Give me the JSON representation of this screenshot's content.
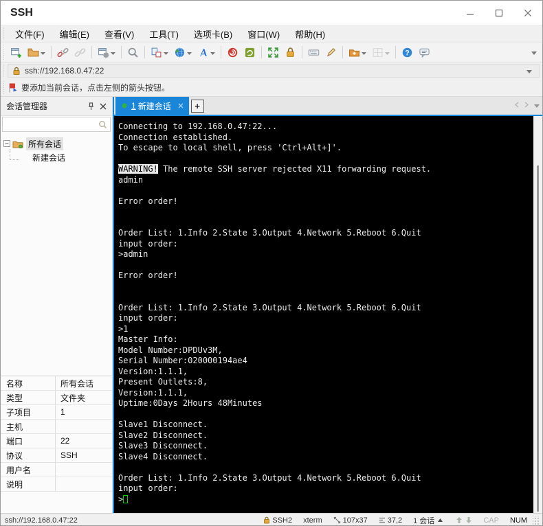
{
  "window": {
    "title": "SSH"
  },
  "menu": {
    "items": [
      {
        "label": "文件(F)"
      },
      {
        "label": "编辑(E)"
      },
      {
        "label": "查看(V)"
      },
      {
        "label": "工具(T)"
      },
      {
        "label": "选项卡(B)"
      },
      {
        "label": "窗口(W)"
      },
      {
        "label": "帮助(H)"
      }
    ]
  },
  "toolbar": {
    "buttons": [
      {
        "icon": "new-session-icon",
        "dropdown": false,
        "sep_before": false,
        "disabled": false
      },
      {
        "icon": "open-folder-icon",
        "dropdown": true,
        "sep_before": false,
        "disabled": false
      },
      {
        "icon": "disconnect-icon",
        "dropdown": false,
        "sep_before": true,
        "disabled": false
      },
      {
        "icon": "reconnect-icon",
        "dropdown": false,
        "sep_before": false,
        "disabled": true
      },
      {
        "icon": "session-properties-icon",
        "dropdown": true,
        "sep_before": true,
        "disabled": false
      },
      {
        "icon": "find-icon",
        "dropdown": false,
        "sep_before": true,
        "disabled": false
      },
      {
        "icon": "layout-tabs-icon",
        "dropdown": true,
        "sep_before": true,
        "disabled": false
      },
      {
        "icon": "web-icon",
        "dropdown": true,
        "sep_before": false,
        "disabled": false
      },
      {
        "icon": "font-icon",
        "dropdown": true,
        "sep_before": false,
        "disabled": false
      },
      {
        "icon": "trace-icon",
        "dropdown": false,
        "sep_before": true,
        "disabled": false
      },
      {
        "icon": "log-icon",
        "dropdown": false,
        "sep_before": false,
        "disabled": false
      },
      {
        "icon": "fullscreen-icon",
        "dropdown": false,
        "sep_before": true,
        "disabled": false
      },
      {
        "icon": "lock-icon",
        "dropdown": false,
        "sep_before": false,
        "disabled": false
      },
      {
        "icon": "keyboard-icon",
        "dropdown": false,
        "sep_before": true,
        "disabled": false
      },
      {
        "icon": "highlight-pen-icon",
        "dropdown": false,
        "sep_before": false,
        "disabled": false
      },
      {
        "icon": "new-folder-icon",
        "dropdown": true,
        "sep_before": true,
        "disabled": false
      },
      {
        "icon": "grid-layout-icon",
        "dropdown": true,
        "sep_before": false,
        "disabled": true
      },
      {
        "icon": "help-icon",
        "dropdown": false,
        "sep_before": true,
        "disabled": false
      },
      {
        "icon": "message-icon",
        "dropdown": false,
        "sep_before": false,
        "disabled": false
      }
    ]
  },
  "address_bar": {
    "value": "ssh://192.168.0.47:22"
  },
  "notice": {
    "text": "要添加当前会话，点击左侧的箭头按钮。"
  },
  "sidebar": {
    "title": "会话管理器",
    "search_placeholder": "",
    "tree": [
      {
        "label": "所有会话",
        "level": 0,
        "selected": true
      },
      {
        "label": "新建会话",
        "level": 1,
        "selected": false
      }
    ],
    "properties": [
      {
        "label": "名称",
        "value": "所有会话"
      },
      {
        "label": "类型",
        "value": "文件夹"
      },
      {
        "label": "子项目",
        "value": "1"
      },
      {
        "label": "主机",
        "value": ""
      },
      {
        "label": "端口",
        "value": "22"
      },
      {
        "label": "协议",
        "value": "SSH"
      },
      {
        "label": "用户名",
        "value": ""
      },
      {
        "label": "说明",
        "value": ""
      }
    ]
  },
  "tabs": {
    "active_index": "1",
    "active_label": "新建会话",
    "new_tab_label": "+"
  },
  "terminal": {
    "lines": [
      [
        {
          "t": "Connecting to 192.168.0.47:22..."
        }
      ],
      [
        {
          "t": "Connection established."
        }
      ],
      [
        {
          "t": "To escape to local shell, press 'Ctrl+Alt+]'."
        }
      ],
      [],
      [
        {
          "t": "WARNING!",
          "s": "inv"
        },
        {
          "t": " The remote SSH server rejected X11 forwarding request."
        }
      ],
      [
        {
          "t": "admin"
        }
      ],
      [],
      [
        {
          "t": "Error order!"
        }
      ],
      [],
      [],
      [
        {
          "t": "Order List: 1.Info 2.State 3.Output 4.Network 5.Reboot 6.Quit"
        }
      ],
      [
        {
          "t": "input order:"
        }
      ],
      [
        {
          "t": ">admin"
        }
      ],
      [],
      [
        {
          "t": "Error order!"
        }
      ],
      [],
      [],
      [
        {
          "t": "Order List: 1.Info 2.State 3.Output 4.Network 5.Reboot 6.Quit"
        }
      ],
      [
        {
          "t": "input order:"
        }
      ],
      [
        {
          "t": ">1"
        }
      ],
      [
        {
          "t": "Master Info:"
        }
      ],
      [
        {
          "t": "Model Number:DPDUv3M,"
        }
      ],
      [
        {
          "t": "Serial Number:020000194ae4"
        }
      ],
      [
        {
          "t": "Version:1.1.1,"
        }
      ],
      [
        {
          "t": "Present Outlets:8,"
        }
      ],
      [
        {
          "t": "Version:1.1.1,"
        }
      ],
      [
        {
          "t": "Uptime:0Days 2Hours 48Minutes"
        }
      ],
      [],
      [
        {
          "t": "Slave1 Disconnect."
        }
      ],
      [
        {
          "t": "Slave2 Disconnect."
        }
      ],
      [
        {
          "t": "Slave3 Disconnect."
        }
      ],
      [
        {
          "t": "Slave4 Disconnect."
        }
      ],
      [],
      [
        {
          "t": "Order List: 1.Info 2.State 3.Output 4.Network 5.Reboot 6.Quit"
        }
      ],
      [
        {
          "t": "input order:"
        }
      ],
      [
        {
          "t": ">"
        },
        {
          "s": "cursor"
        }
      ]
    ]
  },
  "status_bar": {
    "url": "ssh://192.168.0.47:22",
    "encryption": "SSH2",
    "terminal_type": "xterm",
    "screen_size": "107x37",
    "cursor_position": "37,2",
    "session_count": "1 会话",
    "caps_lock": "CAP",
    "num_lock": "NUM"
  },
  "colors": {
    "accent": "#1a86d9",
    "terminal_bg": "#000000",
    "terminal_fg": "#ebebeb",
    "cursor_green": "#00d800",
    "tab_active_bg": "#1a86d9",
    "lock_gold": "#d9a43a",
    "warning_inverse_bg": "#e8e8e8"
  }
}
